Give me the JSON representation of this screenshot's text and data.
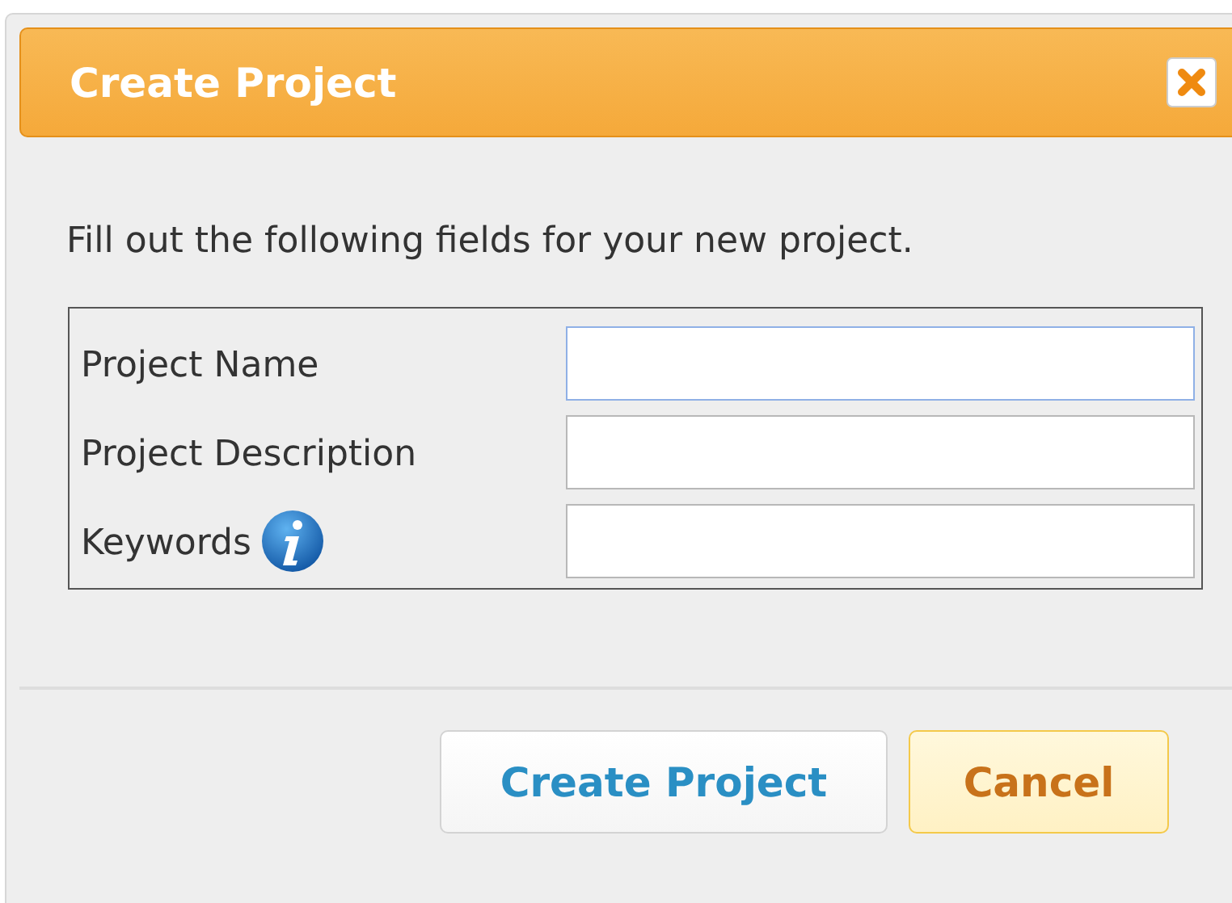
{
  "dialog": {
    "title": "Create Project"
  },
  "intro": "Fill out the following fields for your new project.",
  "fields": [
    {
      "label": "Project Name",
      "info": false,
      "focused": true
    },
    {
      "label": "Project Description",
      "info": false,
      "focused": false
    },
    {
      "label": "Keywords",
      "info": true,
      "focused": false
    }
  ],
  "buttons": [
    {
      "label": "Create Project",
      "kind": "primary"
    },
    {
      "label": "Cancel",
      "kind": "cancel"
    }
  ]
}
